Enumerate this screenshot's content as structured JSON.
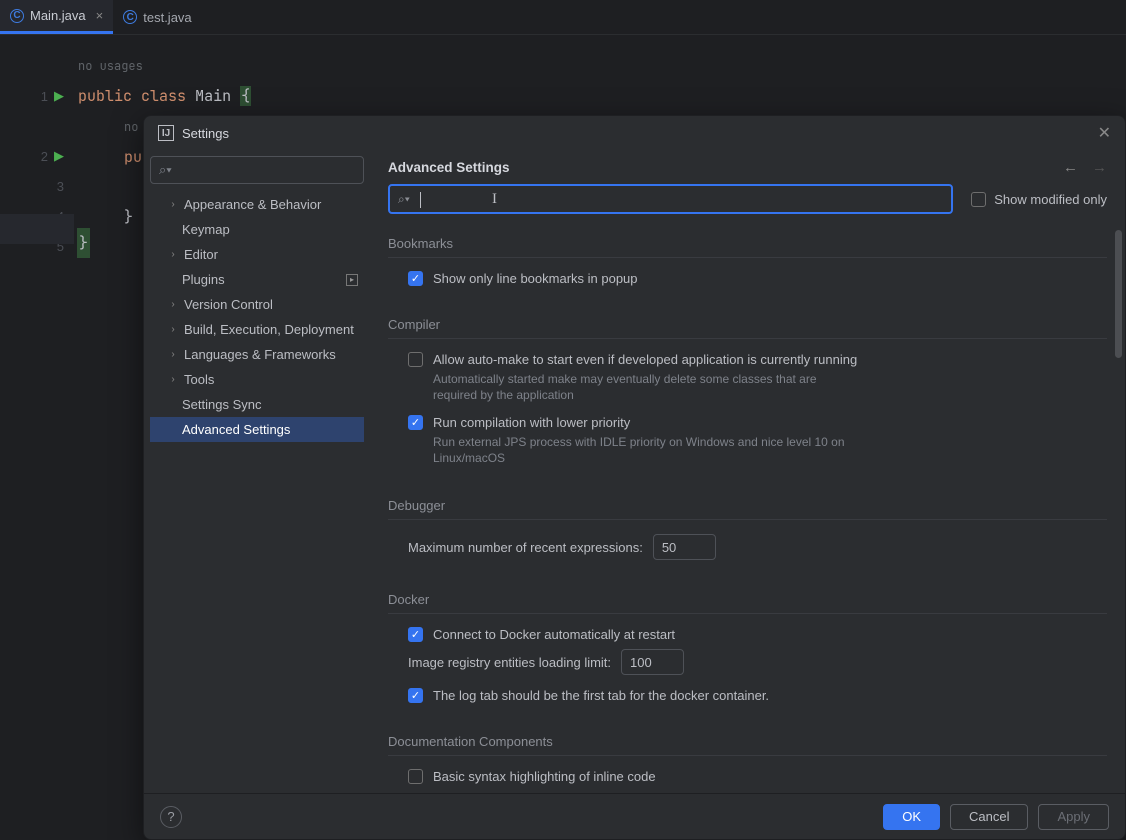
{
  "tabs": [
    {
      "name": "Main.java",
      "active": true
    },
    {
      "name": "test.java",
      "active": false
    }
  ],
  "editor": {
    "usage_hint": "no usages",
    "line2_usage": "no",
    "kw_public": "public",
    "kw_class": "class",
    "class_name": "Main",
    "open_brace": "{",
    "line2_prefix": "pu",
    "line4_close": "}",
    "line5_close": "}",
    "line_numbers": [
      "1",
      "2",
      "3",
      "4",
      "5"
    ]
  },
  "dialog": {
    "title": "Settings",
    "close_glyph": "✕",
    "sidebar": {
      "search_mag": "⌕▾",
      "items": [
        {
          "label": "Appearance & Behavior",
          "expandable": true
        },
        {
          "label": "Keymap",
          "expandable": false
        },
        {
          "label": "Editor",
          "expandable": true
        },
        {
          "label": "Plugins",
          "expandable": false,
          "badge": true
        },
        {
          "label": "Version Control",
          "expandable": true
        },
        {
          "label": "Build, Execution, Deployment",
          "expandable": true
        },
        {
          "label": "Languages & Frameworks",
          "expandable": true
        },
        {
          "label": "Tools",
          "expandable": true
        },
        {
          "label": "Settings Sync",
          "expandable": false
        },
        {
          "label": "Advanced Settings",
          "expandable": false,
          "selected": true
        }
      ]
    },
    "content": {
      "title": "Advanced Settings",
      "search_mag": "⌕▾",
      "show_modified_only": "Show modified only",
      "sections": {
        "bookmarks": {
          "title": "Bookmarks",
          "opt1": {
            "label": "Show only line bookmarks in popup",
            "checked": true
          }
        },
        "compiler": {
          "title": "Compiler",
          "opt1": {
            "label": "Allow auto-make to start even if developed application is currently running",
            "checked": false,
            "hint": "Automatically started make may eventually delete some classes that are required by the application"
          },
          "opt2": {
            "label": "Run compilation with lower priority",
            "checked": true,
            "hint": "Run external JPS process with IDLE priority on Windows and nice level 10 on Linux/macOS"
          }
        },
        "debugger": {
          "title": "Debugger",
          "field_label": "Maximum number of recent expressions:",
          "field_value": "50"
        },
        "docker": {
          "title": "Docker",
          "opt1": {
            "label": "Connect to Docker automatically at restart",
            "checked": true
          },
          "field_label": "Image registry entities loading limit:",
          "field_value": "100",
          "opt2": {
            "label": "The log tab should be the first tab for the docker container.",
            "checked": true
          }
        },
        "doc_components": {
          "title": "Documentation Components",
          "opt1": {
            "label": "Basic syntax highlighting of inline code",
            "checked": false
          }
        }
      }
    },
    "footer": {
      "ok": "OK",
      "cancel": "Cancel",
      "apply": "Apply"
    }
  }
}
